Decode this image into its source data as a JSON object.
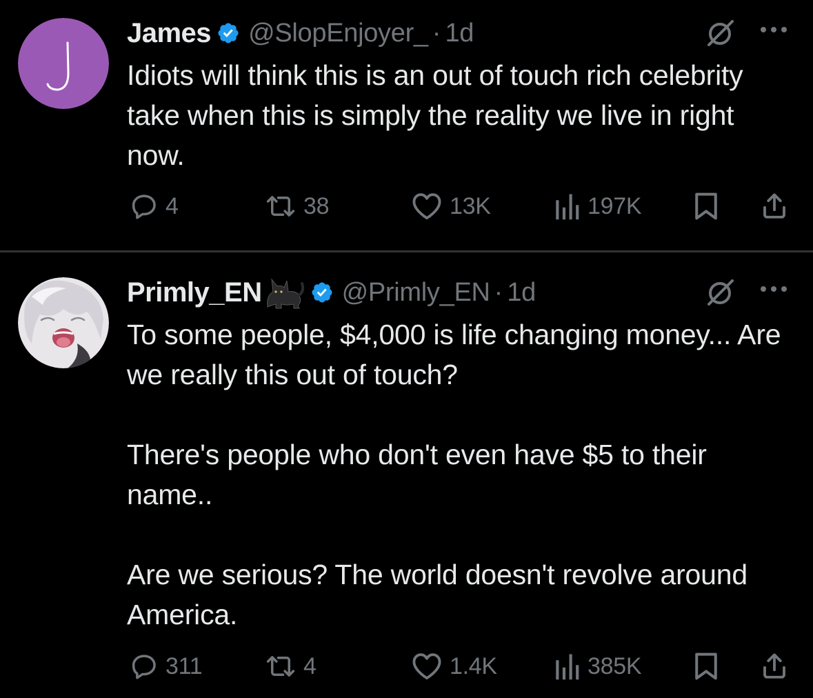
{
  "colors": {
    "background": "#000000",
    "text_primary": "#e7e9ea",
    "text_secondary": "#71767b",
    "verified_blue": "#1d9bf0",
    "divider": "#2f3336",
    "avatar_purple": "#9b59b6"
  },
  "tweets": [
    {
      "avatar": {
        "letter": "J"
      },
      "display_name": "James",
      "handle": "@SlopEnjoyer_",
      "separator": "·",
      "time": "1d",
      "verified": true,
      "icons": [
        "grok-icon",
        "more-icon"
      ],
      "body": [
        "Idiots will think this is an out of touch rich celebrity take when this is simply the reality we live in right now."
      ],
      "stats": {
        "replies": "4",
        "reposts": "38",
        "likes": "13K",
        "views": "197K"
      }
    },
    {
      "avatar": {
        "icon": "anime-avatar"
      },
      "display_name": "Primly_EN",
      "name_emoji": "🐈‍⬛",
      "handle": "@Primly_EN",
      "separator": "·",
      "time": "1d",
      "verified": true,
      "icons": [
        "grok-icon",
        "more-icon"
      ],
      "body": [
        "To some people, $4,000 is life changing money...  Are we really this out of touch?",
        "There's people who don't even have $5 to their name..",
        "Are we serious? The world doesn't revolve around America."
      ],
      "stats": {
        "replies": "311",
        "reposts": "4",
        "likes": "1.4K",
        "views": "385K"
      }
    }
  ]
}
